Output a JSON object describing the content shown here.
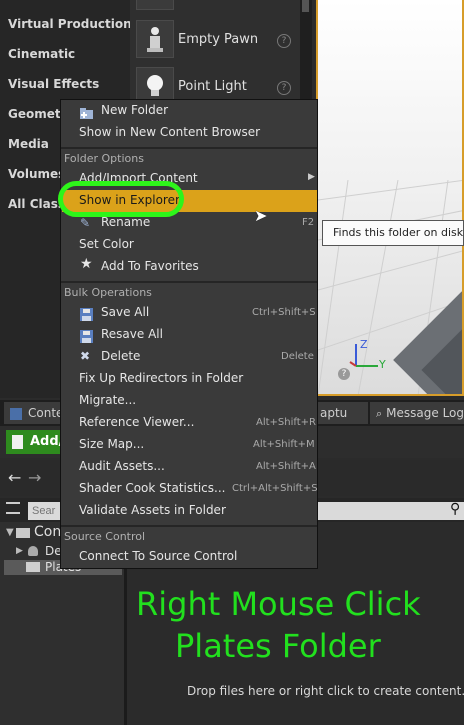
{
  "categories": [
    "Virtual Production",
    "Cinematic",
    "Visual Effects",
    "Geometry",
    "Media",
    "Volumes",
    "All Classes"
  ],
  "assets": [
    {
      "label": "Empty Pawn",
      "icon": "pawn-icon"
    },
    {
      "label": "Point Light",
      "icon": "light-bulb-icon"
    }
  ],
  "tooltip": "Finds this folder on disk.",
  "viewport": {
    "axis_z": "Z",
    "axis_y": "Y"
  },
  "context_menu": {
    "new_folder": "New Folder",
    "show_in_new_cb": "Show in New Content Browser",
    "folder_options_header": "Folder Options",
    "add_import": "Add/Import Content",
    "show_in_explorer": "Show in Explorer",
    "rename": "Rename",
    "rename_shortcut": "F2",
    "set_color": "Set Color",
    "add_favorites": "Add To Favorites",
    "bulk_header": "Bulk Operations",
    "save_all": "Save All",
    "save_all_shortcut": "Ctrl+Shift+S",
    "resave_all": "Resave All",
    "delete": "Delete",
    "delete_shortcut": "Delete",
    "fix_up": "Fix Up Redirectors in Folder",
    "migrate": "Migrate...",
    "ref_viewer": "Reference Viewer...",
    "ref_viewer_shortcut": "Alt+Shift+R",
    "size_map": "Size Map...",
    "size_map_shortcut": "Alt+Shift+M",
    "audit": "Audit Assets...",
    "audit_shortcut": "Alt+Shift+A",
    "shader_stats": "Shader Cook Statistics...",
    "shader_stats_shortcut": "Ctrl+Alt+Shift+S",
    "validate": "Validate Assets in Folder",
    "source_header": "Source Control",
    "connect_sc": "Connect To Source Control"
  },
  "content_browser": {
    "tab_label": "Conte",
    "tab_capture": "aptu",
    "tab_message_log": "Message Log",
    "add_button": "Add/",
    "search_placeholder": "Sear",
    "tree": {
      "content": "Con",
      "dev": "De",
      "plates": "Plates"
    },
    "drop_hint": "Drop files here or right click to create content."
  },
  "annotation": {
    "line1": "Right Mouse Click",
    "line2": "Plates Folder"
  },
  "colors": {
    "highlight": "#dba21a",
    "annotation_green": "#22e01e",
    "add_button": "#2e8b1e",
    "viewport_border": "#d79d2a"
  }
}
